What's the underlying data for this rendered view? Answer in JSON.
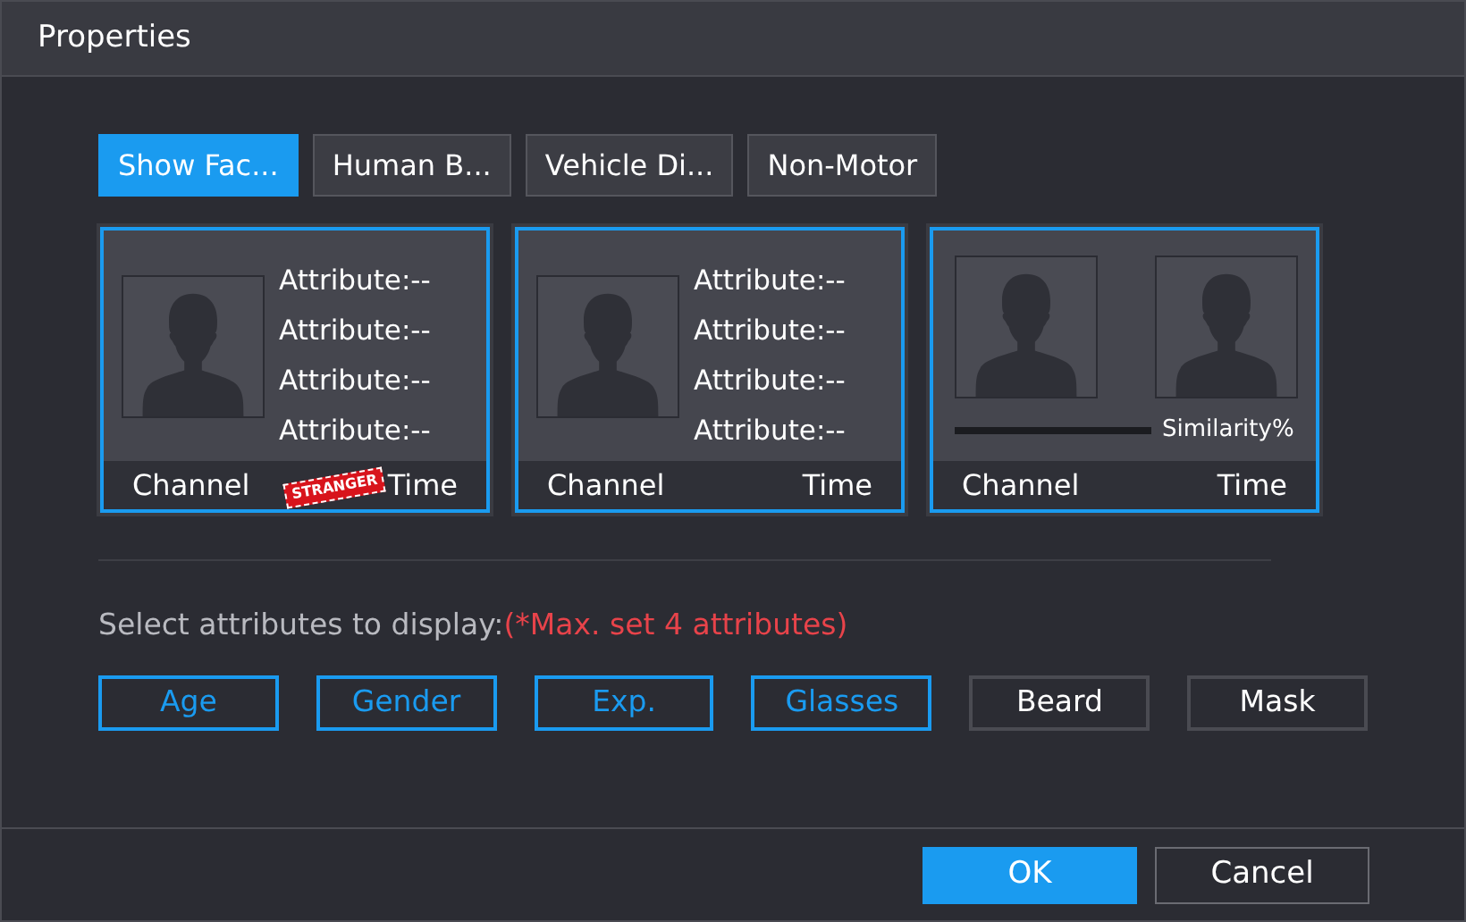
{
  "window": {
    "title": "Properties"
  },
  "tabs": [
    {
      "label": "Show Fac...",
      "selected": true
    },
    {
      "label": "Human B...",
      "selected": false
    },
    {
      "label": "Vehicle Di...",
      "selected": false
    },
    {
      "label": "Non-Motor",
      "selected": false
    }
  ],
  "previews": [
    {
      "kind": "attributes",
      "attributes": [
        "Attribute:--",
        "Attribute:--",
        "Attribute:--",
        "Attribute:--"
      ],
      "stamp": "STRANGER",
      "channel": "Channel",
      "time": "Time"
    },
    {
      "kind": "attributes",
      "attributes": [
        "Attribute:--",
        "Attribute:--",
        "Attribute:--",
        "Attribute:--"
      ],
      "channel": "Channel",
      "time": "Time"
    },
    {
      "kind": "compare",
      "similarity": "Similarity%",
      "channel": "Channel",
      "time": "Time"
    }
  ],
  "prompt": {
    "label": "Select attributes to display:",
    "note": "(*Max. set 4 attributes)"
  },
  "attributes": [
    {
      "label": "Age",
      "selected": true
    },
    {
      "label": "Gender",
      "selected": true
    },
    {
      "label": "Exp.",
      "selected": true
    },
    {
      "label": "Glasses",
      "selected": true
    },
    {
      "label": "Beard",
      "selected": false
    },
    {
      "label": "Mask",
      "selected": false
    }
  ],
  "buttons": [
    {
      "label": "OK",
      "kind": "primary"
    },
    {
      "label": "Cancel",
      "kind": "secondary"
    }
  ]
}
